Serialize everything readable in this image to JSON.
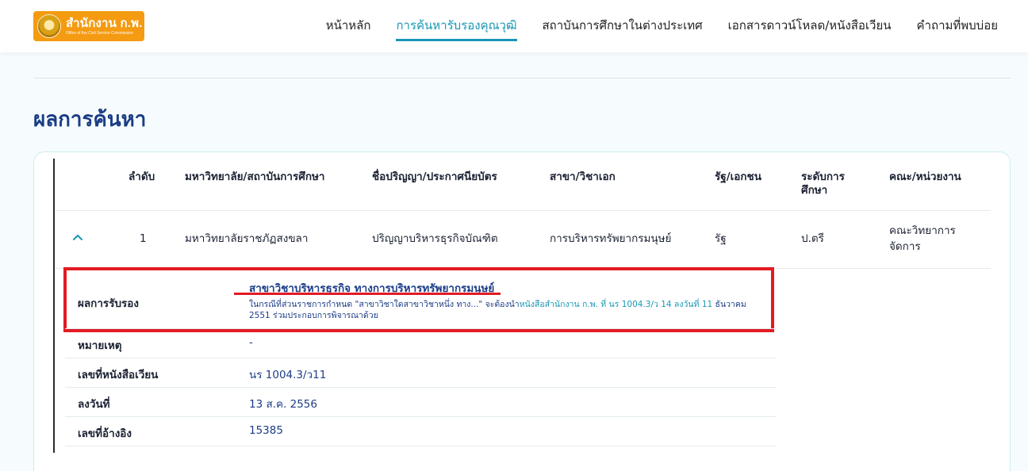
{
  "logo": {
    "main": "สำนักงาน ก.พ.",
    "sub": "Office of the Civil Service Commission"
  },
  "nav": {
    "items": [
      {
        "label": "หน้าหลัก",
        "active": false
      },
      {
        "label": "การค้นหารับรองคุณวุฒิ",
        "active": true
      },
      {
        "label": "สถาบันการศึกษาในต่างประเทศ",
        "active": false
      },
      {
        "label": "เอกสารดาวน์โหลด/หนังสือเวียน",
        "active": false
      },
      {
        "label": "คำถามที่พบบ่อย",
        "active": false
      }
    ]
  },
  "page": {
    "title": "ผลการค้นหา"
  },
  "table": {
    "headers": {
      "no": "ลำดับ",
      "university": "มหาวิทยาลัย/สถาบันการศึกษา",
      "degree": "ชื่อปริญญา/ประกาศนียบัตร",
      "major": "สาขา/วิชาเอก",
      "sector": "รัฐ/เอกชน",
      "level": "ระดับการศึกษา",
      "faculty": "คณะ/หน่วยงาน"
    },
    "row": {
      "no": "1",
      "university": "มหาวิทยาลัยราชภัฏสงขลา",
      "degree": "ปริญญาบริหารธุรกิจบัณฑิต",
      "major": "การบริหารทรัพยากรมนุษย์",
      "sector": "รัฐ",
      "level": "ป.ตรี",
      "faculty": "คณะวิทยาการจัดการ"
    }
  },
  "details": {
    "result_label": "ผลการรับรอง",
    "result_value": "สาขาวิชาบริหารธุรกิจ ทางการบริหารทรัพยากรมนุษย์",
    "result_note_prefix": "ในกรณีที่ส่วนราชการกำหนด \"สาขาวิชาใดสาขาวิชาหนึ่ง ทาง...\" จะต้องนำ",
    "result_note_link": "หนังสือสำนักงาน ก.พ. ที่ นร 1004.3/ว 14 ลงวันที่ 11",
    "result_note_suffix": "ธันวาคม 2551 ร่วมประกอบการพิจารณาด้วย",
    "remark_label": "หมายเหตุ",
    "remark_value": "-",
    "circular_label": "เลขที่หนังสือเวียน",
    "circular_value": "นร 1004.3/ว11",
    "date_label": "ลงวันที่",
    "date_value": "13 ส.ค. 2556",
    "ref_label": "เลขที่อ้างอิง",
    "ref_value": "15385"
  },
  "colors": {
    "accent": "#1797b5",
    "title": "#1b3d87",
    "highlight": "#e31b23",
    "logo": "#f49b12"
  }
}
